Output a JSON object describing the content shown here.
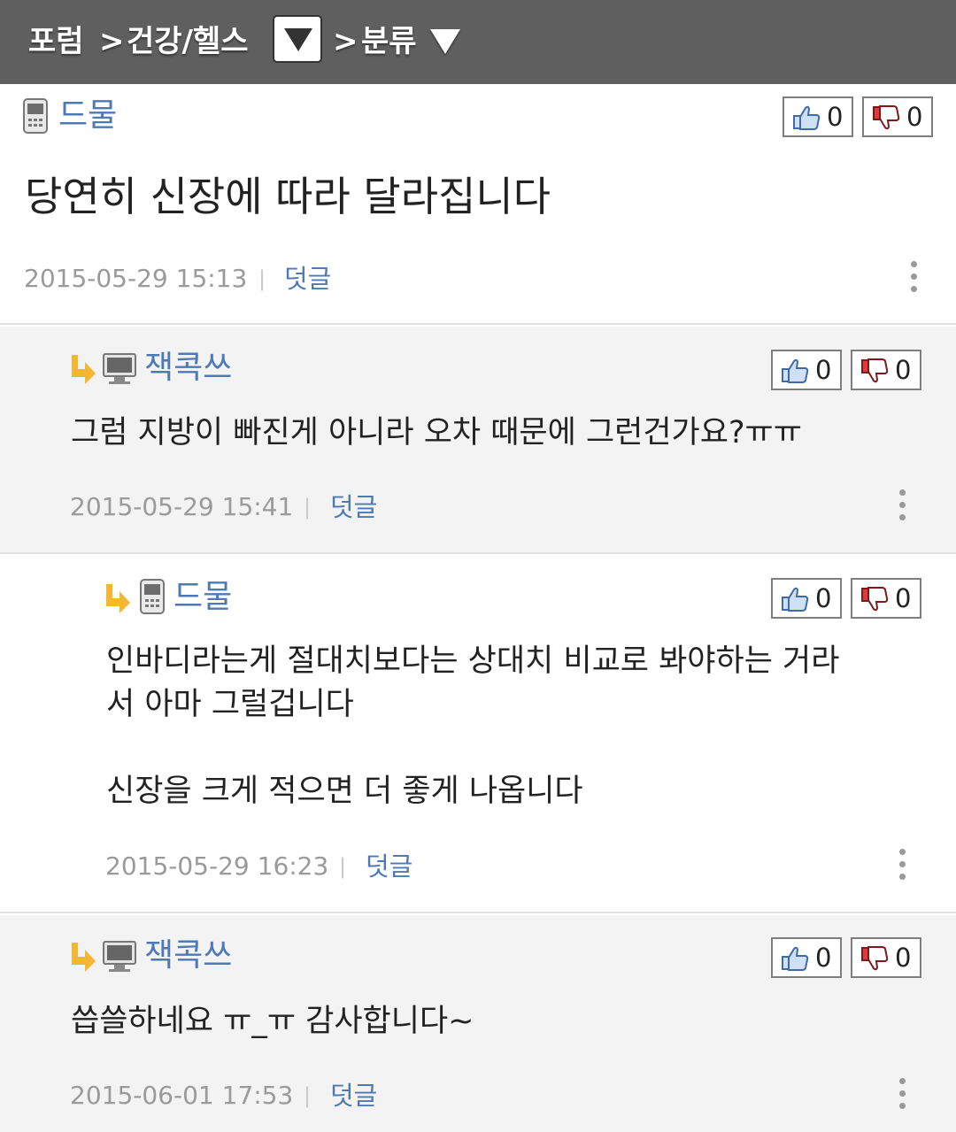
{
  "breadcrumb": {
    "root": "포럼",
    "category": "건강/헬스",
    "sort": "분류",
    "separator": ">"
  },
  "comments": [
    {
      "author": "드물",
      "device": "phone-icon",
      "reply": false,
      "lines": [
        "당연히 신장에 따라 달라집니다"
      ],
      "date": "2015-05-29 15:13",
      "reply_label": "덧글",
      "likes": "0",
      "dislikes": "0"
    },
    {
      "author": "잭콕쓰",
      "device": "computer-icon",
      "reply": true,
      "lines": [
        "그럼 지방이 빠진게 아니라 오차 때문에 그런건가요?ㅠㅠ"
      ],
      "date": "2015-05-29 15:41",
      "reply_label": "덧글",
      "likes": "0",
      "dislikes": "0"
    },
    {
      "author": "드물",
      "device": "phone-icon",
      "reply": true,
      "lines": [
        "인바디라는게 절대치보다는 상대치 비교로 봐야하는 거라",
        "서 아마 그럴겁니다",
        "신장을 크게 적으면 더 좋게 나옵니다"
      ],
      "date": "2015-05-29 16:23",
      "reply_label": "덧글",
      "likes": "0",
      "dislikes": "0"
    },
    {
      "author": "잭콕쓰",
      "device": "computer-icon",
      "reply": true,
      "lines": [
        "씁쓸하네요 ㅠ_ㅠ 감사합니다~"
      ],
      "date": "2015-06-01 17:53",
      "reply_label": "덧글",
      "likes": "0",
      "dislikes": "0"
    }
  ],
  "colors": {
    "topbar": "#5f5f5f",
    "author": "#4d79b7",
    "alt_background": "#f3f3f3",
    "reply_arrow": "#f5b731"
  }
}
